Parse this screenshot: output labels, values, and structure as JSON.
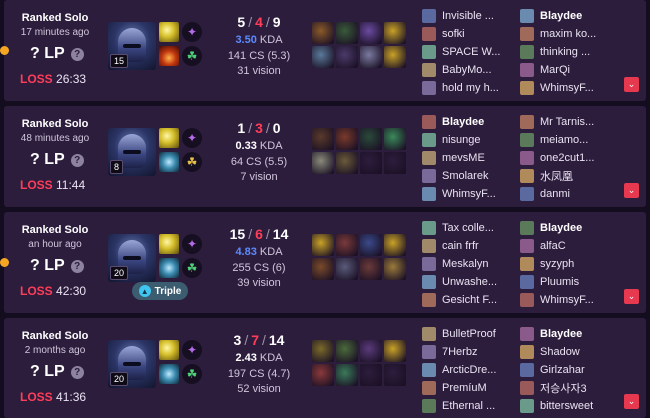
{
  "matches": [
    {
      "queue": "Ranked Solo",
      "ago": "17 minutes ago",
      "lp": "? LP",
      "result": "LOSS",
      "duration": "26:33",
      "level": "15",
      "k": "5",
      "d": "4",
      "a": "9",
      "kda": "3.50",
      "kda_label": "KDA",
      "kda_color": "#5b8bff",
      "cs": "141 CS (5.3)",
      "vision": "31 vision",
      "badge": "",
      "team1": [
        "Invisible ...",
        "sofki",
        "SPACE W...",
        "BabyMo...",
        "hold my h..."
      ],
      "team2": [
        "Blaydee",
        "maxim ko...",
        "thinking ...",
        "MarQi",
        "WhimsyF..."
      ],
      "me_team": 2,
      "me_index": 0
    },
    {
      "queue": "Ranked Solo",
      "ago": "48 minutes ago",
      "lp": "? LP",
      "result": "LOSS",
      "duration": "11:44",
      "level": "8",
      "k": "1",
      "d": "3",
      "a": "0",
      "kda": "0.33",
      "kda_label": "KDA",
      "kda_color": "#ffffff",
      "cs": "64 CS (5.5)",
      "vision": "7 vision",
      "badge": "",
      "team1": [
        "Blaydee",
        "nisunge",
        "mevsME",
        "Smolarek",
        "WhimsyF..."
      ],
      "team2": [
        "Mr Tarnis...",
        "meiamo...",
        "one2cut1...",
        "水凤凰",
        "danmi"
      ],
      "me_team": 1,
      "me_index": 0
    },
    {
      "queue": "Ranked Solo",
      "ago": "an hour ago",
      "lp": "? LP",
      "result": "LOSS",
      "duration": "42:30",
      "level": "20",
      "k": "15",
      "d": "6",
      "a": "14",
      "kda": "4.83",
      "kda_label": "KDA",
      "kda_color": "#5b8bff",
      "cs": "255 CS (6)",
      "vision": "39 vision",
      "badge": "Triple",
      "team1": [
        "Tax colle...",
        "cain frfr",
        "Meskalyn",
        "Unwashe...",
        "Gesicht F..."
      ],
      "team2": [
        "Blaydee",
        "alfaC",
        "syzyph",
        "Pluumis",
        "WhimsyF..."
      ],
      "me_team": 2,
      "me_index": 0
    },
    {
      "queue": "Ranked Solo",
      "ago": "2 months ago",
      "lp": "? LP",
      "result": "LOSS",
      "duration": "41:36",
      "level": "20",
      "k": "3",
      "d": "7",
      "a": "14",
      "kda": "2.43",
      "kda_label": "KDA",
      "kda_color": "#ffffff",
      "cs": "197 CS (4.7)",
      "vision": "52 vision",
      "badge": "",
      "team1": [
        "BulletProof",
        "7Herbz",
        "ArcticDre...",
        "PremíuM",
        "Ethernal ..."
      ],
      "team2": [
        "Blaydee",
        "Shadow",
        "Girlzahar",
        "저승사자3",
        "bittersweet"
      ],
      "me_team": 2,
      "me_index": 0
    }
  ],
  "colors": {
    "background": "#140d1f",
    "card": "#2d1d3d",
    "loss": "#ff3d59",
    "accent": "#e63950",
    "live_dot": "#f5a623"
  },
  "icons": {
    "lp_help": "help-icon",
    "expand": "chevron-down-icon",
    "badge": "triangle-icon"
  },
  "lp_help_glyph": "?",
  "expand_glyph": "⌄",
  "badge_glyph": "▲"
}
